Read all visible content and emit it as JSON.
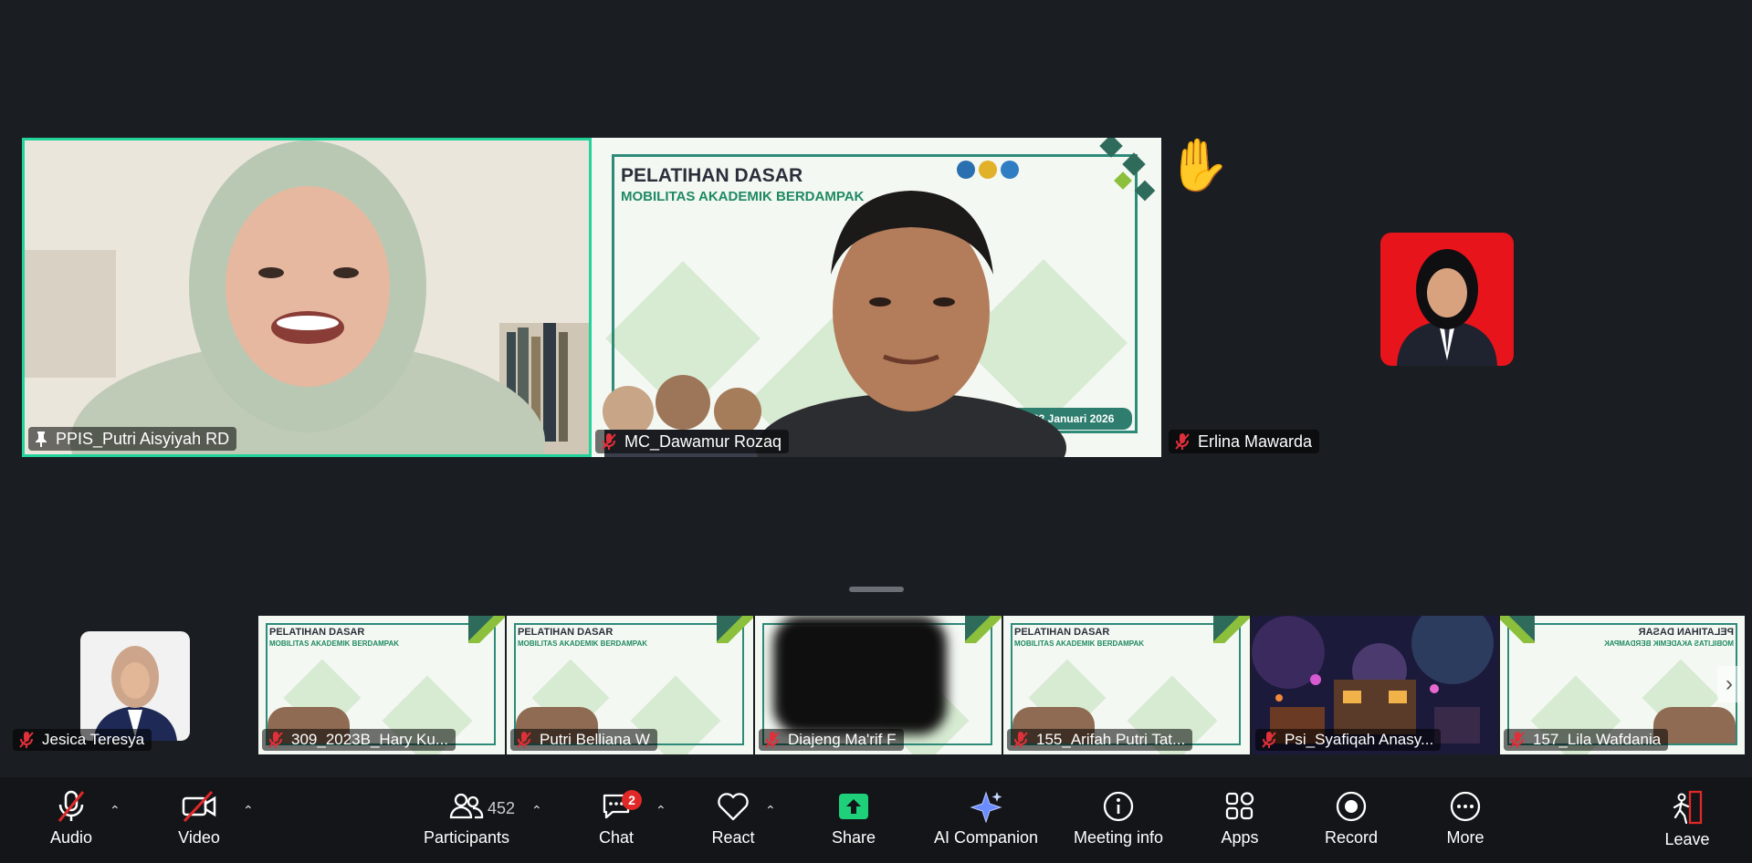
{
  "main_tiles": [
    {
      "name": "PPIS_Putri Aisyiyah RD",
      "pinned": true
    },
    {
      "name": "MC_Dawamur Rozaq",
      "muted": true
    },
    {
      "name": "Erlina Mawarda",
      "muted": true,
      "raised_hand": true
    }
  ],
  "slide": {
    "title": "PELATIHAN DASAR",
    "subtitle": "MOBILITAS AKADEMIK BERDAMPAK",
    "date": "19-23 Januari 2026"
  },
  "strip_tiles": [
    {
      "name": "Jesica Teresya",
      "muted": true
    },
    {
      "name": "309_2023B_Hary Ku...",
      "muted": true
    },
    {
      "name": "Putri Belliana W",
      "muted": true
    },
    {
      "name": "Diajeng Ma'rif F",
      "muted": true
    },
    {
      "name": "155_Arifah Putri Tat...",
      "muted": true
    },
    {
      "name": "Psi_Syafiqah Anasy...",
      "muted": true
    },
    {
      "name": "157_Lila Wafdania",
      "muted": true
    }
  ],
  "toolbar": {
    "audio": "Audio",
    "video": "Video",
    "participants": "Participants",
    "participants_count": "452",
    "chat": "Chat",
    "chat_badge": "2",
    "react": "React",
    "share": "Share",
    "ai_companion": "AI Companion",
    "meeting_info": "Meeting info",
    "apps": "Apps",
    "record": "Record",
    "more": "More",
    "leave": "Leave"
  },
  "colors": {
    "active_speaker_border": "#22d39a",
    "share_green": "#1ed07a",
    "badge_red": "#e02828",
    "avatar_red_bg": "#e8141c"
  }
}
